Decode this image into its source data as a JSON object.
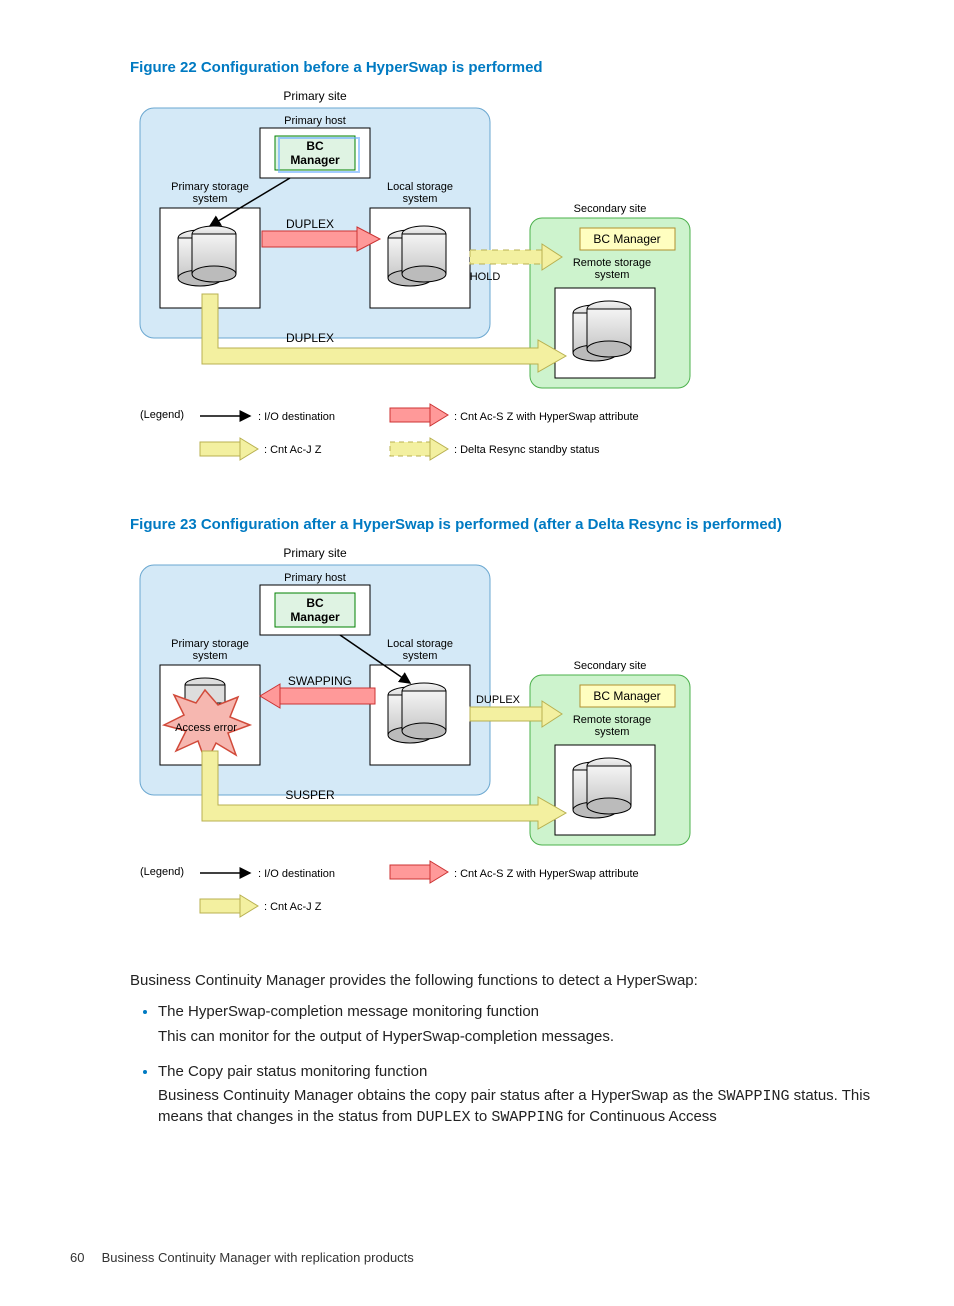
{
  "figure22": {
    "caption": "Figure 22 Configuration before a HyperSwap is performed",
    "labels": {
      "primary_site": "Primary site",
      "primary_host": "Primary host",
      "bc_manager": "BC Manager",
      "primary_storage1": "Primary storage",
      "primary_storage2": "system",
      "local_storage1": "Local storage",
      "local_storage2": "system",
      "secondary_site": "Secondary site",
      "bc_manager2": "BC Manager",
      "remote_storage1": "Remote storage",
      "remote_storage2": "system",
      "duplex1": "DUPLEX",
      "duplex2": "DUPLEX",
      "hold": "HOLD",
      "legend": "(Legend)",
      "io_dest": ": I/O destination",
      "cntacj": ": Cnt Ac-J Z",
      "cntacs": ": Cnt Ac-S Z with HyperSwap attribute",
      "delta": ": Delta Resync standby status"
    }
  },
  "figure23": {
    "caption": "Figure 23 Configuration after a HyperSwap is performed (after a Delta Resync is performed)",
    "labels": {
      "primary_site": "Primary site",
      "primary_host": "Primary host",
      "bc_manager": "BC Manager",
      "primary_storage1": "Primary storage",
      "primary_storage2": "system",
      "local_storage1": "Local storage",
      "local_storage2": "system",
      "secondary_site": "Secondary site",
      "bc_manager2": "BC Manager",
      "remote_storage1": "Remote storage",
      "remote_storage2": "system",
      "swapping": "SWAPPING",
      "susper": "SUSPER",
      "duplex": "DUPLEX",
      "access_error": "Access error",
      "legend": "(Legend)",
      "io_dest": ": I/O destination",
      "cntacj": ": Cnt Ac-J Z",
      "cntacs": ": Cnt Ac-S Z with HyperSwap attribute"
    }
  },
  "body": {
    "intro": "Business Continuity Manager provides the following functions to detect a HyperSwap:",
    "item1_head": "The HyperSwap-completion message monitoring function",
    "item1_body": "This can monitor for the output of HyperSwap-completion messages.",
    "item2_head": "The Copy pair status monitoring function",
    "item2_body_a": "Business Continuity Manager obtains the copy pair status after a HyperSwap as the ",
    "item2_mono1": "SWAPPING",
    "item2_body_b": " status. This means that changes in the status from ",
    "item2_mono2": "DUPLEX",
    "item2_body_c": " to ",
    "item2_mono3": "SWAPPING",
    "item2_body_d": " for Continuous Access"
  },
  "footer": {
    "page": "60",
    "section": "Business Continuity Manager with replication products"
  }
}
